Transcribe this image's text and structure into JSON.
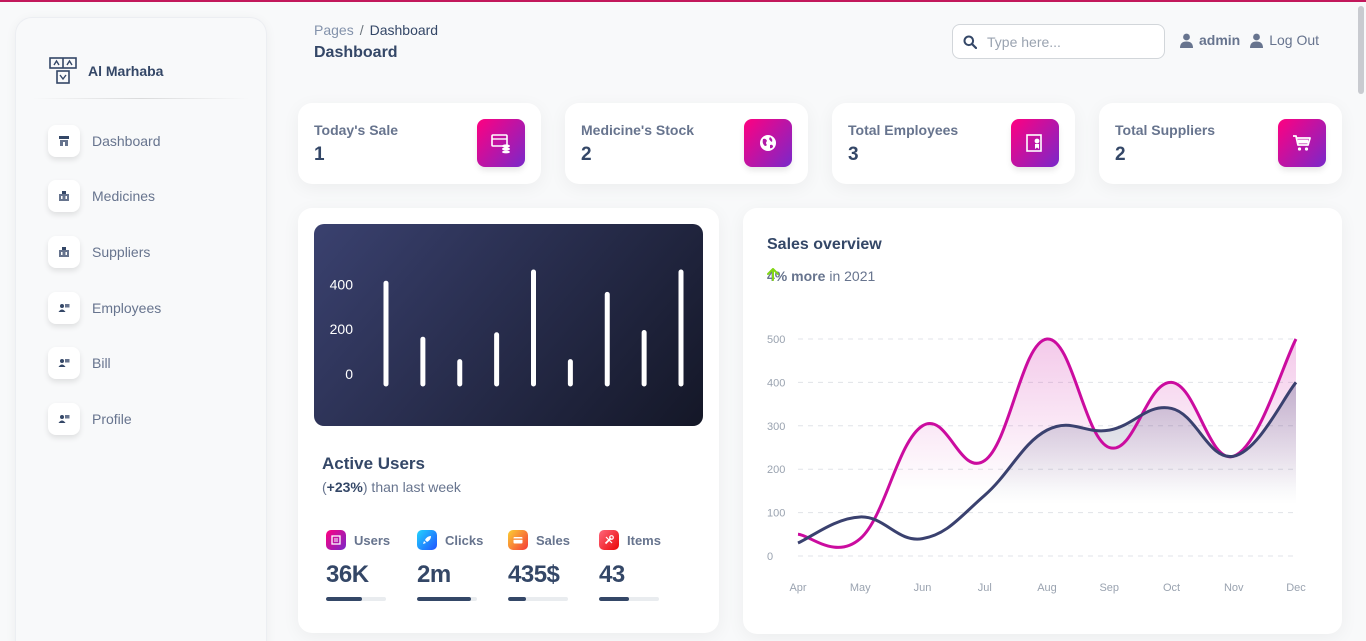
{
  "brand": {
    "name": "Al Marhaba"
  },
  "sidebar": {
    "items": [
      {
        "label": "Dashboard",
        "icon": "shop-icon"
      },
      {
        "label": "Medicines",
        "icon": "office-icon"
      },
      {
        "label": "Suppliers",
        "icon": "office-icon"
      },
      {
        "label": "Employees",
        "icon": "user-card-icon"
      },
      {
        "label": "Bill",
        "icon": "user-card-icon"
      },
      {
        "label": "Profile",
        "icon": "user-card-icon"
      }
    ]
  },
  "header": {
    "breadcrumb_parent": "Pages",
    "breadcrumb_separator": "/",
    "breadcrumb_current": "Dashboard",
    "title": "Dashboard",
    "search_placeholder": "Type here...",
    "user": "admin",
    "logout": "Log Out"
  },
  "stats": [
    {
      "title": "Today's Sale",
      "value": "1",
      "icon": "money-coins-icon"
    },
    {
      "title": "Medicine's Stock",
      "value": "2",
      "icon": "world-icon"
    },
    {
      "title": "Total Employees",
      "value": "3",
      "icon": "paper-diploma-icon"
    },
    {
      "title": "Total Suppliers",
      "value": "2",
      "icon": "cart-icon"
    }
  ],
  "active_users": {
    "title": "Active Users",
    "subtitle_prefix": "(",
    "subtitle_bold": "+23%",
    "subtitle_rest": ") than last week",
    "metrics": [
      {
        "label": "Users",
        "value": "36K",
        "progress": 0.6,
        "color": "#cb0c9f",
        "icon": "library-icon"
      },
      {
        "label": "Clicks",
        "value": "2m",
        "progress": 0.9,
        "color": "#17c1e8",
        "icon": "rocket-icon"
      },
      {
        "label": "Sales",
        "value": "435$",
        "progress": 0.3,
        "color": "#f53939",
        "icon": "credit-card-icon"
      },
      {
        "label": "Items",
        "value": "43",
        "progress": 0.5,
        "color": "#ea0606",
        "icon": "tools-icon"
      }
    ]
  },
  "chart_data": [
    {
      "type": "bar",
      "ylim": [
        0,
        500
      ],
      "yticks": [
        "0",
        "200",
        "400"
      ],
      "values": [
        450,
        200,
        100,
        220,
        500,
        100,
        400,
        230,
        500
      ],
      "grid": false,
      "color": "#ffffff"
    },
    {
      "type": "area",
      "title": "Sales overview",
      "subtitle_pct": "4% more",
      "subtitle_rest": "in 2021",
      "categories": [
        "Apr",
        "May",
        "Jun",
        "Jul",
        "Aug",
        "Sep",
        "Oct",
        "Nov",
        "Dec"
      ],
      "yticks": [
        "0",
        "100",
        "200",
        "300",
        "400",
        "500"
      ],
      "ylim": [
        0,
        500
      ],
      "grid": true,
      "series": [
        {
          "color": "#cb0c9f",
          "values": [
            50,
            40,
            300,
            220,
            500,
            250,
            400,
            230,
            500
          ]
        },
        {
          "color": "#3a416f",
          "values": [
            30,
            90,
            40,
            140,
            290,
            290,
            340,
            230,
            400
          ]
        }
      ]
    }
  ]
}
